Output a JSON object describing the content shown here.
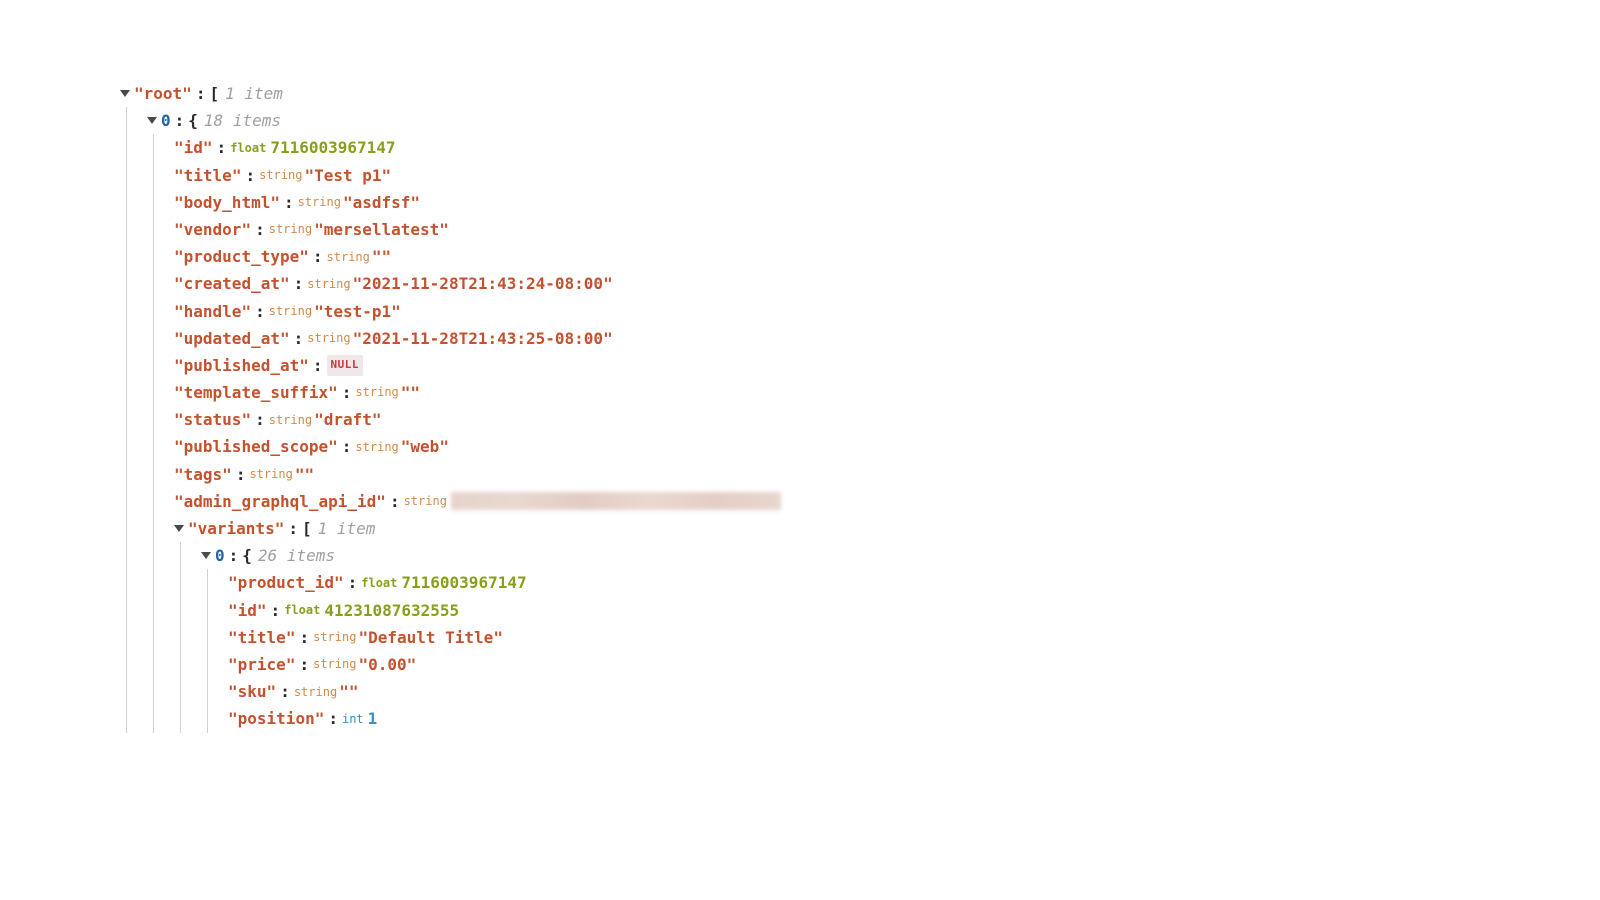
{
  "root": {
    "label": "root",
    "open_bracket": "[",
    "meta": "1 item",
    "item0": {
      "idx": "0",
      "open_brace": "{",
      "meta": "18 items",
      "fields": {
        "id": {
          "key": "id",
          "type": "float",
          "val": "7116003967147"
        },
        "title": {
          "key": "title",
          "type": "string",
          "val": "\"Test p1\""
        },
        "body_html": {
          "key": "body_html",
          "type": "string",
          "val": "\"asdfsf\""
        },
        "vendor": {
          "key": "vendor",
          "type": "string",
          "val": "\"mersellatest\""
        },
        "product_type": {
          "key": "product_type",
          "type": "string",
          "val": "\"\""
        },
        "created_at": {
          "key": "created_at",
          "type": "string",
          "val": "\"2021-11-28T21:43:24-08:00\""
        },
        "handle": {
          "key": "handle",
          "type": "string",
          "val": "\"test-p1\""
        },
        "updated_at": {
          "key": "updated_at",
          "type": "string",
          "val": "\"2021-11-28T21:43:25-08:00\""
        },
        "published_at": {
          "key": "published_at",
          "type": "null",
          "val": "NULL"
        },
        "template_suffix": {
          "key": "template_suffix",
          "type": "string",
          "val": "\"\""
        },
        "status": {
          "key": "status",
          "type": "string",
          "val": "\"draft\""
        },
        "published_scope": {
          "key": "published_scope",
          "type": "string",
          "val": "\"web\""
        },
        "tags": {
          "key": "tags",
          "type": "string",
          "val": "\"\""
        },
        "admin_graphql_api_id": {
          "key": "admin_graphql_api_id",
          "type": "string",
          "val": ""
        }
      },
      "variants": {
        "key": "variants",
        "open_bracket": "[",
        "meta": "1 item",
        "item0": {
          "idx": "0",
          "open_brace": "{",
          "meta": "26 items",
          "fields": {
            "product_id": {
              "key": "product_id",
              "type": "float",
              "val": "7116003967147"
            },
            "id": {
              "key": "id",
              "type": "float",
              "val": "41231087632555"
            },
            "title": {
              "key": "title",
              "type": "string",
              "val": "\"Default Title\""
            },
            "price": {
              "key": "price",
              "type": "string",
              "val": "\"0.00\""
            },
            "sku": {
              "key": "sku",
              "type": "string",
              "val": "\"\""
            },
            "position": {
              "key": "position",
              "type": "int",
              "val": "1"
            }
          }
        }
      }
    }
  },
  "type_labels": {
    "float": "float",
    "string": "string",
    "int": "int"
  }
}
